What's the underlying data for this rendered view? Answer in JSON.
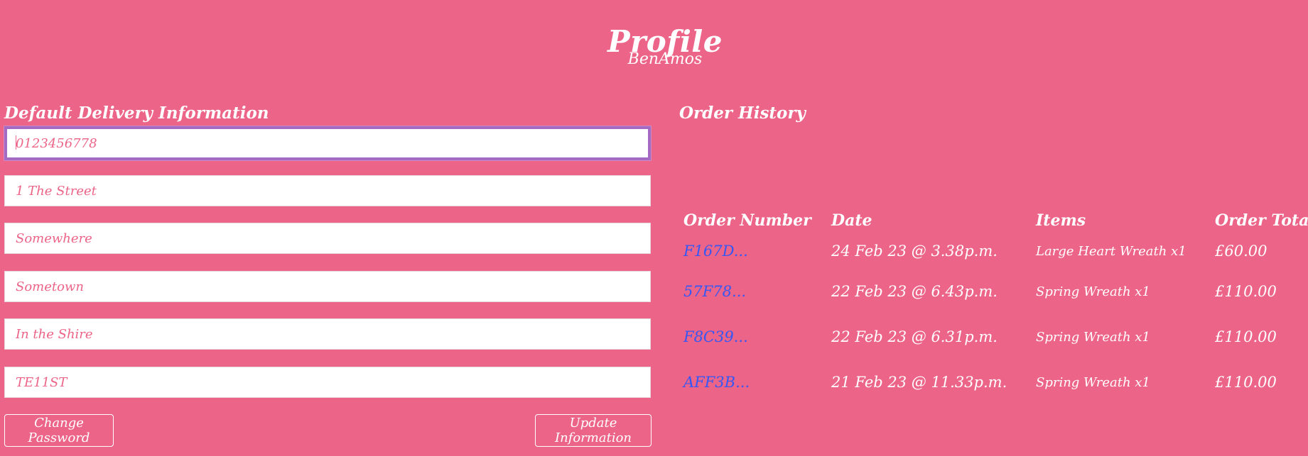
{
  "page": {
    "title": "Profile",
    "username": "BenAmos"
  },
  "delivery": {
    "heading": "Default Delivery Information",
    "fields": [
      {
        "value": "",
        "placeholder": "0123456778"
      },
      {
        "value": "",
        "placeholder": "1 The Street"
      },
      {
        "value": "",
        "placeholder": "Somewhere"
      },
      {
        "value": "",
        "placeholder": "Sometown"
      },
      {
        "value": "",
        "placeholder": "In the Shire"
      },
      {
        "value": "",
        "placeholder": "TE11ST"
      }
    ],
    "change_password_label": "Change Password",
    "update_information_label": "Update Information"
  },
  "orders": {
    "heading": "Order History",
    "columns": {
      "number": "Order Number",
      "date": "Date",
      "items": "Items",
      "total": "Order Total"
    },
    "rows": [
      {
        "number": "F167D...",
        "date": "24 Feb 23 @ 3.38p.m.",
        "items": "Large Heart Wreath x1",
        "total": "£60.00"
      },
      {
        "number": "57F78...",
        "date": "22 Feb 23 @ 6.43p.m.",
        "items": "Spring Wreath x1",
        "total": "£110.00"
      },
      {
        "number": "F8C39...",
        "date": "22 Feb 23 @ 6.31p.m.",
        "items": "Spring Wreath x1",
        "total": "£110.00"
      },
      {
        "number": "AFF3B...",
        "date": "21 Feb 23 @ 11.33p.m.",
        "items": "Spring Wreath x1",
        "total": "£110.00"
      }
    ]
  },
  "colors": {
    "background": "#ec6488",
    "text": "#ffffff",
    "link": "#3557f5",
    "focus_border": "#a56ac4"
  }
}
